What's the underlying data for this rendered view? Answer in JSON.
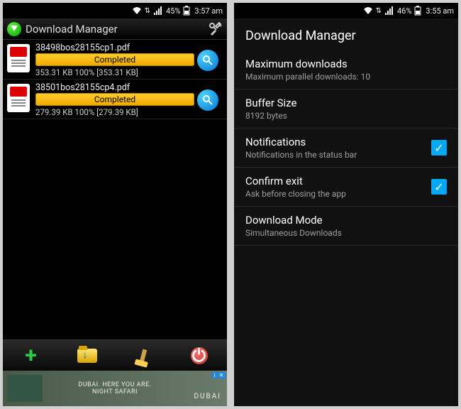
{
  "left": {
    "status": {
      "signal": "45%",
      "time": "3:57 am"
    },
    "header": {
      "title": "Download Manager"
    },
    "downloads": [
      {
        "filename": "38498bos28155cp1.pdf",
        "status_label": "Completed",
        "stats": "353.31 KB   100% [353.31 KB]"
      },
      {
        "filename": "38501bos28155cp4.pdf",
        "status_label": "Completed",
        "stats": "279.39 KB   100% [279.39 KB]"
      }
    ],
    "ad": {
      "line1": "DUBAI. HERE YOU ARE.",
      "line2": "NIGHT SAFARI",
      "brand": "DUBAI"
    }
  },
  "right": {
    "status": {
      "signal": "46%",
      "time": "3:55 am"
    },
    "header": "Download Manager",
    "settings": [
      {
        "title": "Maximum downloads",
        "sub": "Maximum parallel downloads: 10",
        "checkbox": null
      },
      {
        "title": "Buffer Size",
        "sub": "8192 bytes",
        "checkbox": null
      },
      {
        "title": "Notifications",
        "sub": "Notifications in the status bar",
        "checkbox": true
      },
      {
        "title": "Confirm exit",
        "sub": "Ask before closing the app",
        "checkbox": true
      },
      {
        "title": "Download Mode",
        "sub": "Simultaneous Downloads",
        "checkbox": null
      }
    ]
  }
}
